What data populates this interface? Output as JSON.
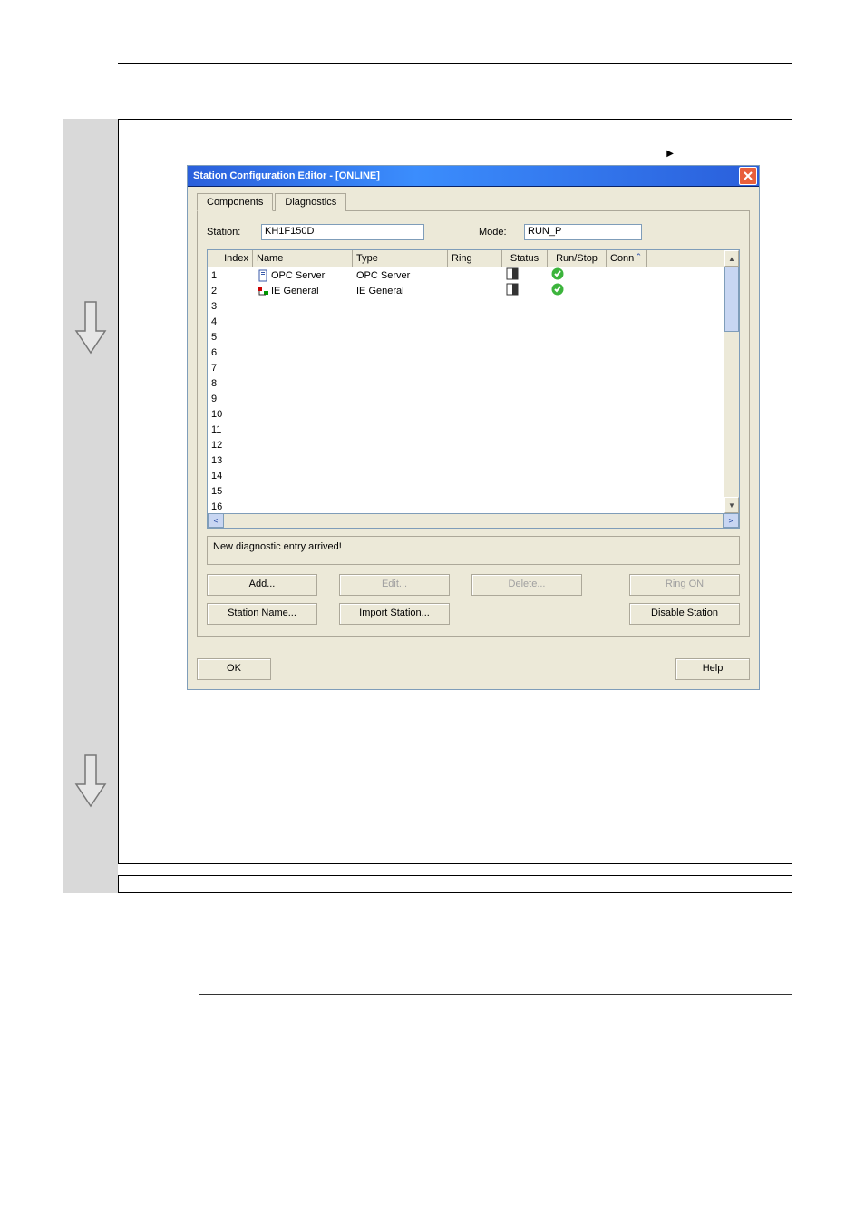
{
  "dialog": {
    "title": "Station Configuration Editor - [ONLINE]",
    "tabs": {
      "components": "Components",
      "diagnostics": "Diagnostics"
    },
    "station_label": "Station:",
    "station_value": "KH1F150D",
    "mode_label": "Mode:",
    "mode_value": "RUN_P",
    "columns": {
      "index": "Index",
      "name": "Name",
      "type": "Type",
      "ring": "Ring",
      "status": "Status",
      "runstop": "Run/Stop",
      "conn": "Conn"
    },
    "rows": [
      {
        "index": "1",
        "name": "OPC Server",
        "type": "OPC Server",
        "status": true,
        "run": true
      },
      {
        "index": "2",
        "name": "IE General",
        "type": "IE General",
        "status": true,
        "run": true
      },
      {
        "index": "3"
      },
      {
        "index": "4"
      },
      {
        "index": "5"
      },
      {
        "index": "6"
      },
      {
        "index": "7"
      },
      {
        "index": "8"
      },
      {
        "index": "9"
      },
      {
        "index": "10"
      },
      {
        "index": "11"
      },
      {
        "index": "12"
      },
      {
        "index": "13"
      },
      {
        "index": "14"
      },
      {
        "index": "15"
      },
      {
        "index": "16"
      }
    ],
    "diagnostic_msg": "New diagnostic entry arrived!",
    "buttons": {
      "add": "Add...",
      "edit": "Edit...",
      "delete": "Delete...",
      "ring_on": "Ring ON",
      "station_name": "Station Name...",
      "import_station": "Import Station...",
      "disable_station": "Disable Station",
      "ok": "OK",
      "help": "Help"
    },
    "scroll_up_caret": "ˆ"
  }
}
